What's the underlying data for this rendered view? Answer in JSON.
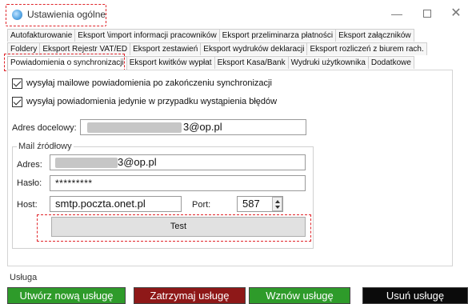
{
  "window": {
    "title": "Ustawienia ogólne",
    "controls": {
      "minimize": "—",
      "maximize": "",
      "close": "✕"
    },
    "icon": "app-globe-icon"
  },
  "tabs": {
    "row1": [
      "Autofakturowanie",
      "Eksport \\import informacji pracowników",
      "Eksport przeliminarza płatności",
      "Eksport załączników"
    ],
    "row2": [
      "Foldery",
      "Eksport Rejestr VAT/ED",
      "Eksport zestawień",
      "Eksport wydruków deklaracji",
      "Eksport rozliczeń z biurem rach."
    ],
    "row3": [
      "Powiadomienia o synchronizacji",
      "Eksport kwitków wypłat",
      "Eksport Kasa/Bank",
      "Wydruki użytkownika",
      "Dodatkowe"
    ],
    "active": "Powiadomienia o synchronizacji"
  },
  "options": {
    "send_email": "wysyłaj mailowe powiadomienia po zakończeniu synchronizacji",
    "only_errors": "wysyłaj powiadomienia jedynie w przypadku wystąpienia błędów",
    "send_email_checked": true,
    "only_errors_checked": true
  },
  "target": {
    "label": "Adres docelowy:",
    "value": "3@op.pl"
  },
  "source": {
    "group_title": "Mail źródłowy",
    "address_label": "Adres:",
    "address_value": "3@op.pl",
    "password_label": "Hasło:",
    "password_value": "*********",
    "host_label": "Host:",
    "host_value": "smtp.poczta.onet.pl",
    "port_label": "Port:",
    "port_value": "587",
    "test_button": "Test"
  },
  "service": {
    "label": "Usługa",
    "create": "Utwórz nową usługę",
    "stop": "Zatrzymaj usługę",
    "resume": "Wznów usługę",
    "delete": "Usuń usługę",
    "colors": {
      "create": "#2e9b2a",
      "stop": "#8e1818",
      "resume": "#2e9b2a",
      "delete": "#0b0b0b"
    }
  }
}
